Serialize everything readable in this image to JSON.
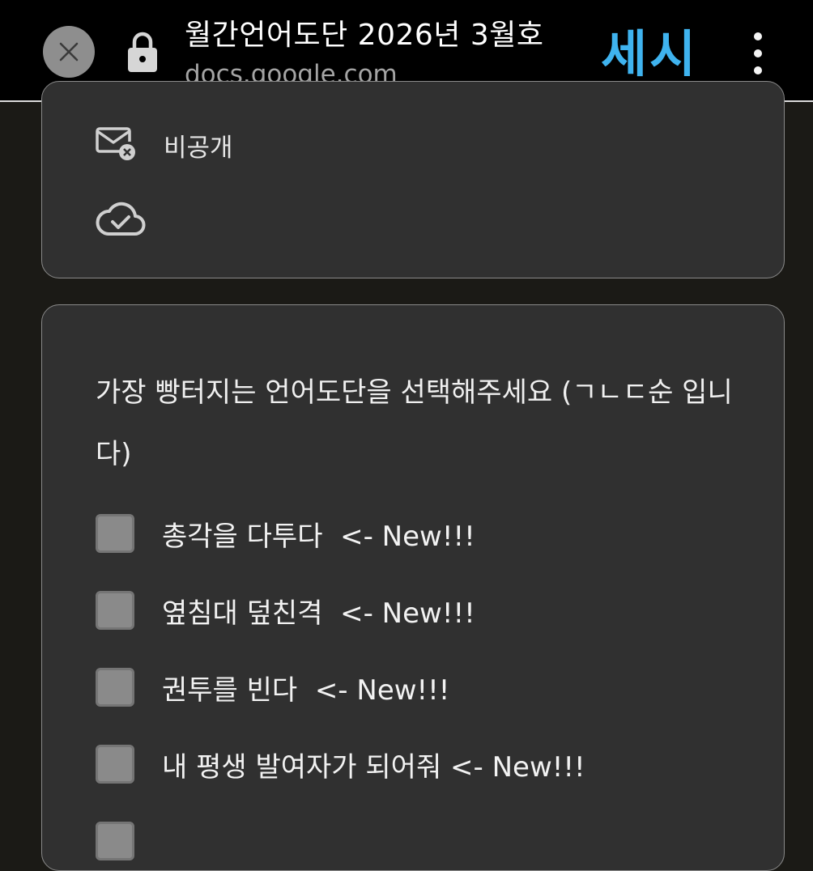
{
  "browser": {
    "close_icon": "close-icon",
    "lock_icon": "lock-icon",
    "page_title": "월간언어도단 2026년 3월호",
    "url": "docs.google.com",
    "brand_text": "세시",
    "menu_icon": "more-vert-icon"
  },
  "status_card": {
    "private_icon": "mail-x-icon",
    "private_label": "비공개",
    "saved_icon": "cloud-check-icon"
  },
  "question": {
    "text": "가장 빵터지는 언어도단을 선택해주세요 (ㄱㄴㄷ순 입니다)",
    "options": [
      {
        "label": "총각을 다투다  <- New!!!"
      },
      {
        "label": "옆침대 덮친격  <- New!!!"
      },
      {
        "label": "권투를 빈다  <- New!!!"
      },
      {
        "label": "내 평생 발여자가 되어줘 <- New!!!"
      },
      {
        "label": ""
      }
    ]
  },
  "colors": {
    "background": "#1b1a16",
    "topbar": "#000000",
    "card": "#303030",
    "brand": "#3fb3ef",
    "checkbox": "#8a8a8a"
  }
}
